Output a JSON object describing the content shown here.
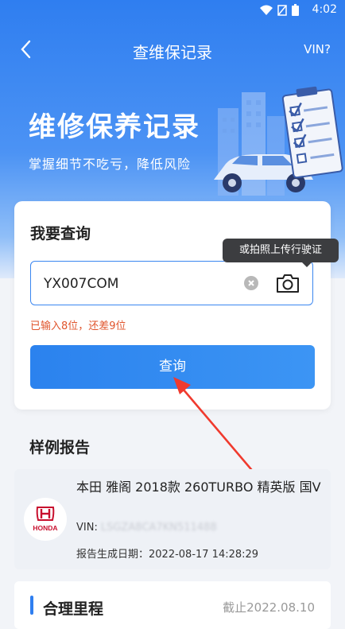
{
  "status_bar": {
    "time": "4:02"
  },
  "app_bar": {
    "title": "查维保记录",
    "vin_link": "VIN?"
  },
  "hero": {
    "headline": "维修保养记录",
    "subline": "掌握细节不吃亏，降低风险"
  },
  "query_card": {
    "heading": "我要查询",
    "input_value": "YX007COM",
    "tooltip": "或拍照上传行驶证",
    "hint": "已输入8位，还差9位",
    "button_label": "查询"
  },
  "sample": {
    "section_title": "样例报告",
    "report_title": "本田 雅阁 2018款 260TURBO 精英版 国V",
    "vin_label": "VIN:",
    "vin_value": "LSGZA8CA7KN511488",
    "date_text": "报告生成日期：2022-08-17 14:28:29",
    "brand_logo_text": "HONDA"
  },
  "bottom_card": {
    "label": "合理里程",
    "date": "截止2022.08.10"
  },
  "colors": {
    "primary": "#2f7ef0",
    "hint": "#e0552d",
    "tooltip_bg": "#3c3d40"
  }
}
